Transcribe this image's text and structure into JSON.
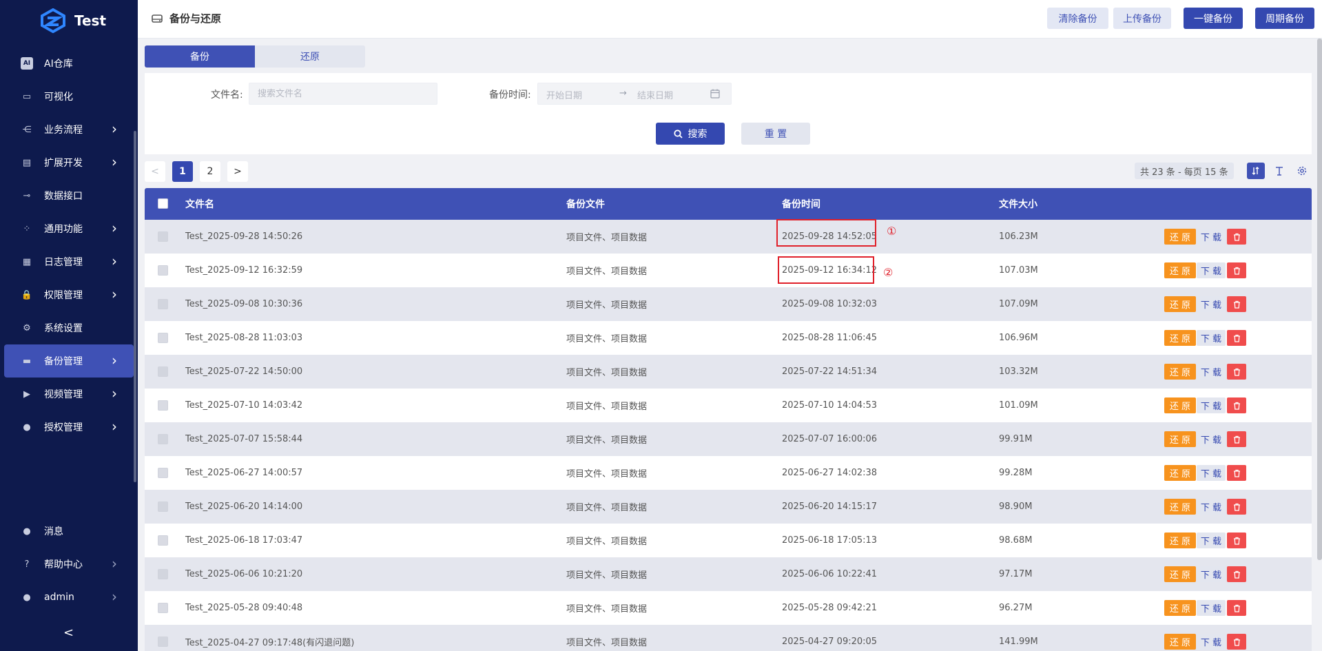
{
  "app": {
    "name": "Test"
  },
  "sidebar": {
    "items": [
      {
        "label": "AI仓库",
        "icon": "ai-icon",
        "glyph": "AI",
        "arrow": false,
        "active": false
      },
      {
        "label": "可视化",
        "icon": "monitor-icon",
        "glyph": "▭",
        "arrow": false,
        "active": false
      },
      {
        "label": "业务流程",
        "icon": "flow-icon",
        "glyph": "⋲",
        "arrow": true,
        "active": false
      },
      {
        "label": "扩展开发",
        "icon": "extension-icon",
        "glyph": "▤",
        "arrow": true,
        "active": false
      },
      {
        "label": "数据接口",
        "icon": "plug-icon",
        "glyph": "⊸",
        "arrow": false,
        "active": false
      },
      {
        "label": "通用功能",
        "icon": "grid-icon",
        "glyph": "⁘",
        "arrow": true,
        "active": false
      },
      {
        "label": "日志管理",
        "icon": "log-icon",
        "glyph": "▦",
        "arrow": true,
        "active": false
      },
      {
        "label": "权限管理",
        "icon": "lock-icon",
        "glyph": "🔒",
        "arrow": true,
        "active": false
      },
      {
        "label": "系统设置",
        "icon": "gear-icon",
        "glyph": "⚙",
        "arrow": false,
        "active": false
      },
      {
        "label": "备份管理",
        "icon": "drive-icon",
        "glyph": "▬",
        "arrow": true,
        "active": true
      },
      {
        "label": "视频管理",
        "icon": "video-icon",
        "glyph": "▶",
        "arrow": true,
        "active": false
      },
      {
        "label": "授权管理",
        "icon": "user-key-icon",
        "glyph": "●",
        "arrow": true,
        "active": false
      }
    ],
    "bottom_items": [
      {
        "label": "消息",
        "icon": "message-icon",
        "glyph": "●",
        "arrow": false
      },
      {
        "label": "帮助中心",
        "icon": "help-icon",
        "glyph": "?",
        "arrow": true
      },
      {
        "label": "admin",
        "icon": "user-icon",
        "glyph": "●",
        "arrow": true
      }
    ],
    "collapse_glyph": "<"
  },
  "header": {
    "title": "备份与还原",
    "buttons": {
      "clear": "清除备份",
      "upload": "上传备份",
      "one_click": "一键备份",
      "periodic": "周期备份"
    }
  },
  "tabs": {
    "backup": "备份",
    "restore": "还原"
  },
  "filter": {
    "filename_label": "文件名:",
    "filename_placeholder": "搜索文件名",
    "time_label": "备份时间:",
    "start_placeholder": "开始日期",
    "arrow": "→",
    "end_placeholder": "结束日期",
    "search": "搜索",
    "reset": "重 置"
  },
  "pagination": {
    "prev": "<",
    "pages": [
      "1",
      "2"
    ],
    "next": ">",
    "total": "共 23 条 - 每页 15 条"
  },
  "table": {
    "headers": {
      "name": "文件名",
      "file": "备份文件",
      "time": "备份时间",
      "size": "文件大小"
    },
    "actions": {
      "restore": "还 原",
      "download": "下 载"
    },
    "rows": [
      {
        "name": "Test_2025-09-28 14:50:26",
        "file": "项目文件、项目数据",
        "time": "2025-09-28 14:52:05",
        "size": "106.23M"
      },
      {
        "name": "Test_2025-09-12 16:32:59",
        "file": "项目文件、项目数据",
        "time": "2025-09-12 16:34:12",
        "size": "107.03M"
      },
      {
        "name": "Test_2025-09-08 10:30:36",
        "file": "项目文件、项目数据",
        "time": "2025-09-08 10:32:03",
        "size": "107.09M"
      },
      {
        "name": "Test_2025-08-28 11:03:03",
        "file": "项目文件、项目数据",
        "time": "2025-08-28 11:06:45",
        "size": "106.96M"
      },
      {
        "name": "Test_2025-07-22 14:50:00",
        "file": "项目文件、项目数据",
        "time": "2025-07-22 14:51:34",
        "size": "103.32M"
      },
      {
        "name": "Test_2025-07-10 14:03:42",
        "file": "项目文件、项目数据",
        "time": "2025-07-10 14:04:53",
        "size": "101.09M"
      },
      {
        "name": "Test_2025-07-07 15:58:44",
        "file": "项目文件、项目数据",
        "time": "2025-07-07 16:00:06",
        "size": "99.91M"
      },
      {
        "name": "Test_2025-06-27 14:00:57",
        "file": "项目文件、项目数据",
        "time": "2025-06-27 14:02:38",
        "size": "99.28M"
      },
      {
        "name": "Test_2025-06-20 14:14:00",
        "file": "项目文件、项目数据",
        "time": "2025-06-20 14:15:17",
        "size": "98.90M"
      },
      {
        "name": "Test_2025-06-18 17:03:47",
        "file": "项目文件、项目数据",
        "time": "2025-06-18 17:05:13",
        "size": "98.68M"
      },
      {
        "name": "Test_2025-06-06 10:21:20",
        "file": "项目文件、项目数据",
        "time": "2025-06-06 10:22:41",
        "size": "97.17M"
      },
      {
        "name": "Test_2025-05-28 09:40:48",
        "file": "项目文件、项目数据",
        "time": "2025-05-28 09:42:21",
        "size": "96.27M"
      },
      {
        "name": "Test_2025-04-27 09:17:48(有闪退问题)",
        "file": "项目文件、项目数据",
        "time": "2025-04-27 09:20:05",
        "size": "141.99M"
      }
    ]
  },
  "annotations": [
    "①",
    "②"
  ],
  "colors": {
    "sidebar": "#0e1a4d",
    "primary": "#3f51b5",
    "restore": "#f7931e",
    "delete": "#f04c4c",
    "highlight": "#e0202a"
  }
}
